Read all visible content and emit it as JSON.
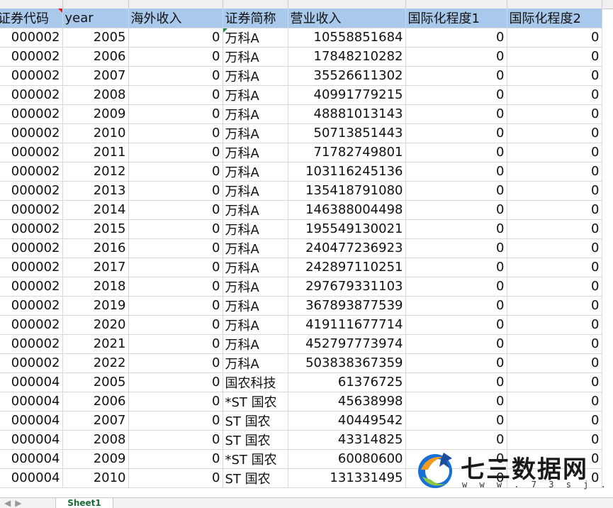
{
  "columns": [
    "证券代码",
    "year",
    "海外收入",
    "证券简称",
    "营业收入",
    "国际化程度1",
    "国际化程度2"
  ],
  "rows": [
    [
      "000002",
      "2005",
      "0",
      "万科A",
      "10558851684",
      "0",
      "0"
    ],
    [
      "000002",
      "2006",
      "0",
      "万科A",
      "17848210282",
      "0",
      "0"
    ],
    [
      "000002",
      "2007",
      "0",
      "万科A",
      "35526611302",
      "0",
      "0"
    ],
    [
      "000002",
      "2008",
      "0",
      "万科A",
      "40991779215",
      "0",
      "0"
    ],
    [
      "000002",
      "2009",
      "0",
      "万科A",
      "48881013143",
      "0",
      "0"
    ],
    [
      "000002",
      "2010",
      "0",
      "万科A",
      "50713851443",
      "0",
      "0"
    ],
    [
      "000002",
      "2011",
      "0",
      "万科A",
      "71782749801",
      "0",
      "0"
    ],
    [
      "000002",
      "2012",
      "0",
      "万科A",
      "103116245136",
      "0",
      "0"
    ],
    [
      "000002",
      "2013",
      "0",
      "万科A",
      "135418791080",
      "0",
      "0"
    ],
    [
      "000002",
      "2014",
      "0",
      "万科A",
      "146388004498",
      "0",
      "0"
    ],
    [
      "000002",
      "2015",
      "0",
      "万科A",
      "195549130021",
      "0",
      "0"
    ],
    [
      "000002",
      "2016",
      "0",
      "万科A",
      "240477236923",
      "0",
      "0"
    ],
    [
      "000002",
      "2017",
      "0",
      "万科A",
      "242897110251",
      "0",
      "0"
    ],
    [
      "000002",
      "2018",
      "0",
      "万科A",
      "297679331103",
      "0",
      "0"
    ],
    [
      "000002",
      "2019",
      "0",
      "万科A",
      "367893877539",
      "0",
      "0"
    ],
    [
      "000002",
      "2020",
      "0",
      "万科A",
      "419111677714",
      "0",
      "0"
    ],
    [
      "000002",
      "2021",
      "0",
      "万科A",
      "452797773974",
      "0",
      "0"
    ],
    [
      "000002",
      "2022",
      "0",
      "万科A",
      "503838367359",
      "0",
      "0"
    ],
    [
      "000004",
      "2005",
      "0",
      "国农科技",
      "61376725",
      "0",
      "0"
    ],
    [
      "000004",
      "2006",
      "0",
      "*ST 国农",
      "45638998",
      "0",
      "0"
    ],
    [
      "000004",
      "2007",
      "0",
      "ST 国农",
      "40449542",
      "0",
      "0"
    ],
    [
      "000004",
      "2008",
      "0",
      "ST 国农",
      "43314825",
      "0",
      "0"
    ],
    [
      "000004",
      "2009",
      "0",
      "*ST 国农",
      "60080600",
      "0",
      "0"
    ],
    [
      "000004",
      "2010",
      "0",
      "ST 国农",
      "131331495",
      "0",
      "0"
    ]
  ],
  "sheet_tab": "Sheet1",
  "watermark": {
    "title": "七三数据网",
    "url": "w w w . 7 3 s j . c o m"
  },
  "colors": {
    "header_bg": "#a9c9ec",
    "grid_line": "#d8d8d8",
    "tab_text": "#1a6b35"
  }
}
